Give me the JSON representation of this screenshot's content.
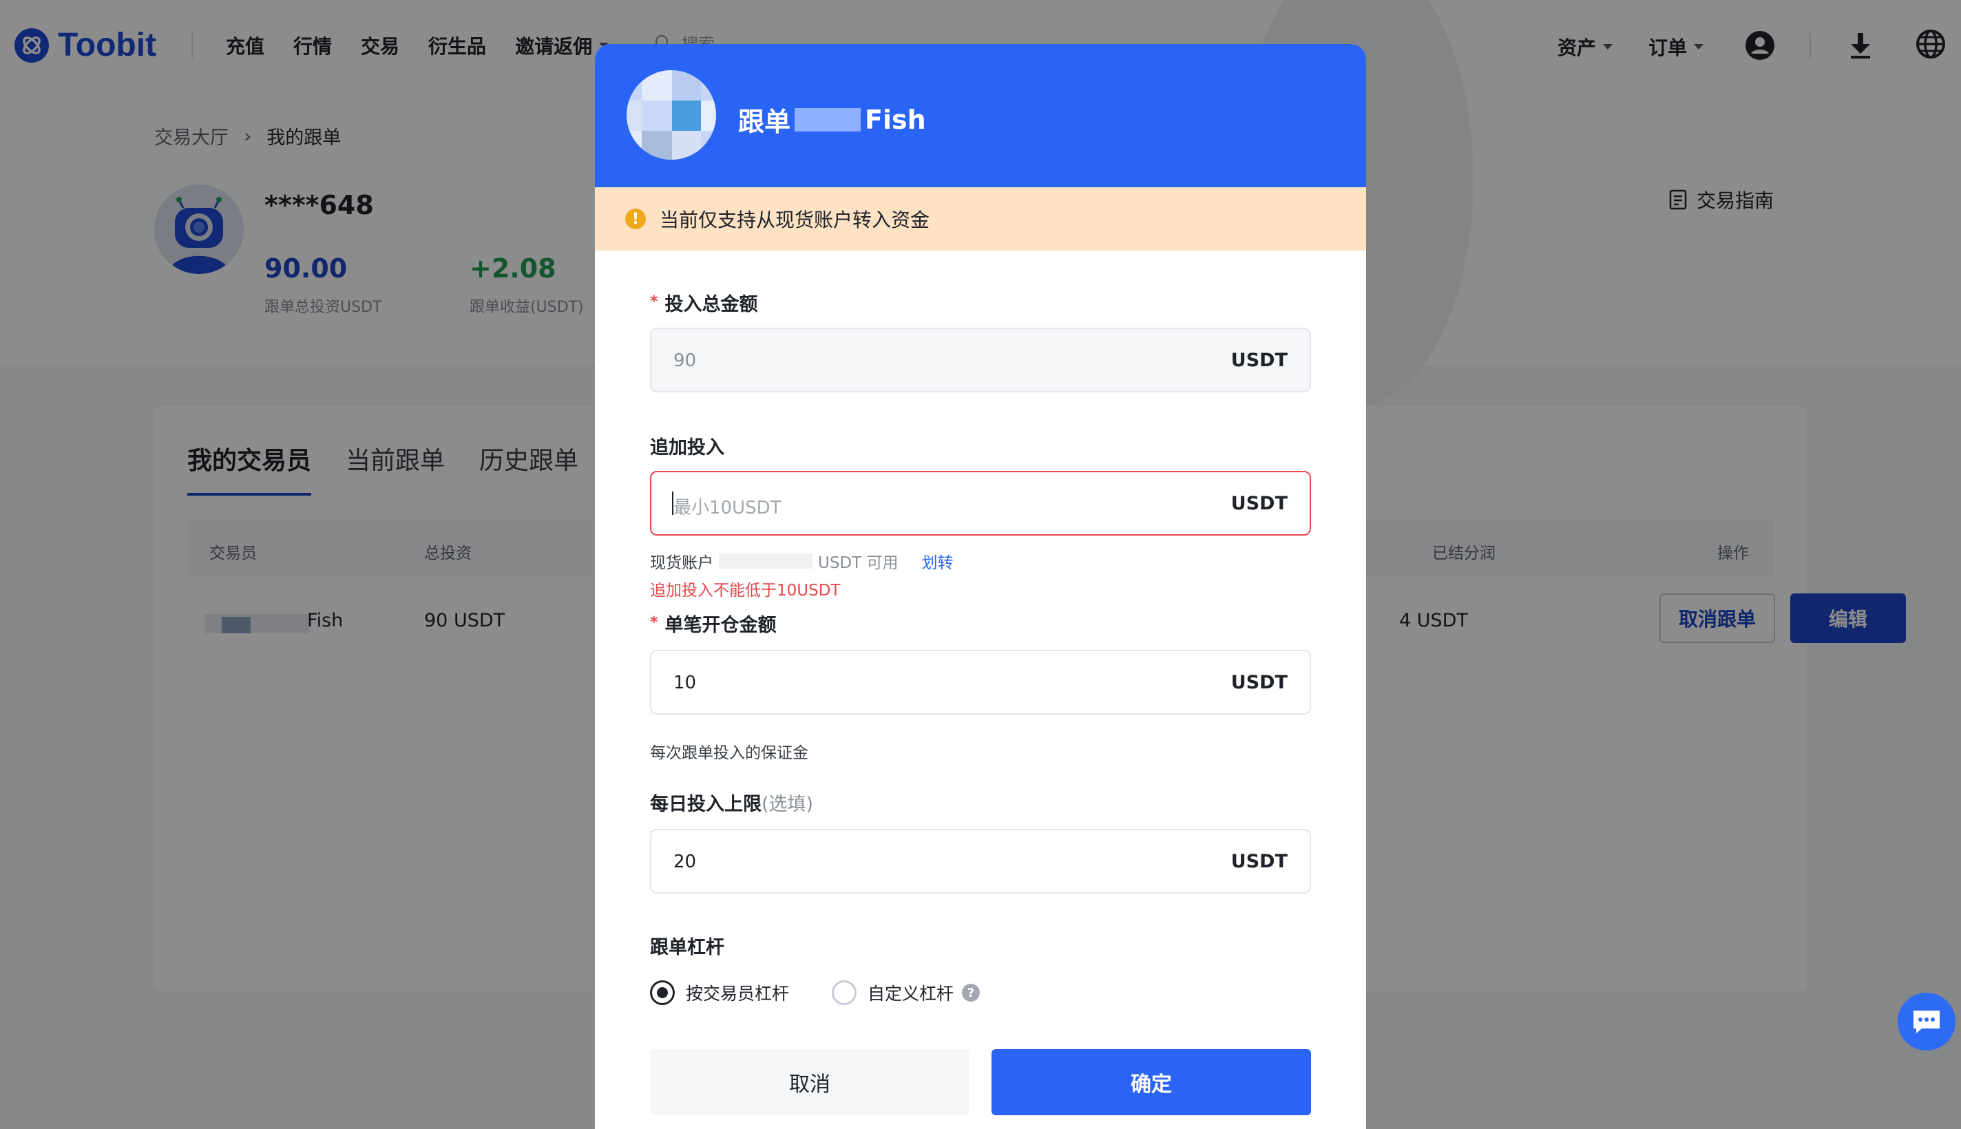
{
  "app": {
    "name": "Toobit"
  },
  "nav": {
    "items": [
      {
        "label": "充值",
        "dropdown": false
      },
      {
        "label": "行情",
        "dropdown": false
      },
      {
        "label": "交易",
        "dropdown": false
      },
      {
        "label": "衍生品",
        "dropdown": false
      },
      {
        "label": "邀请返佣",
        "dropdown": true
      }
    ],
    "search_placeholder": "搜索",
    "assets_label": "资产",
    "orders_label": "订单"
  },
  "breadcrumb": {
    "parent": "交易大厅",
    "current": "我的跟单"
  },
  "profile": {
    "username": "****648",
    "total_invest_value": "90.00",
    "total_invest_label": "跟单总投资USDT",
    "profit_value": "+2.08",
    "profit_label": "跟单收益(USDT)",
    "guide_label": "交易指南"
  },
  "tabs": [
    {
      "label": "我的交易员",
      "active": true
    },
    {
      "label": "当前跟单",
      "active": false
    },
    {
      "label": "历史跟单",
      "active": false
    }
  ],
  "table": {
    "headers": {
      "trader": "交易员",
      "total_invest": "总投资",
      "settled_profit": "已结分润",
      "actions": "操作"
    },
    "rows": [
      {
        "trader": "Fish",
        "total_invest": "90 USDT",
        "settled_profit": "4 USDT"
      }
    ],
    "cancel_follow_label": "取消跟单",
    "edit_label": "编辑"
  },
  "modal": {
    "title_prefix": "跟单",
    "title_suffix": "Fish",
    "notice": "当前仅支持从现货账户转入资金",
    "total_amount": {
      "label": "投入总金额",
      "value": "90",
      "unit": "USDT"
    },
    "add_invest": {
      "label": "追加投入",
      "placeholder": "最小10USDT",
      "unit": "USDT",
      "available_prefix": "现货账户",
      "available_suffix": "USDT 可用",
      "transfer_label": "划转",
      "error": "追加投入不能低于10USDT"
    },
    "single_amount": {
      "label": "单笔开仓金额",
      "value": "10",
      "unit": "USDT",
      "hint": "每次跟单投入的保证金"
    },
    "daily_limit": {
      "label": "每日投入上限",
      "optional": "(选填)",
      "value": "20",
      "unit": "USDT"
    },
    "leverage": {
      "label": "跟单杠杆",
      "options": [
        {
          "label": "按交易员杠杆",
          "checked": true
        },
        {
          "label": "自定义杠杆",
          "checked": false
        }
      ]
    },
    "cancel_label": "取消",
    "confirm_label": "确定"
  },
  "colors": {
    "brand": "#2964f5",
    "accent_dark": "#1f45c8",
    "error": "#e5484d",
    "profit": "#1f9d55",
    "notice_bg": "#fde2c4"
  }
}
